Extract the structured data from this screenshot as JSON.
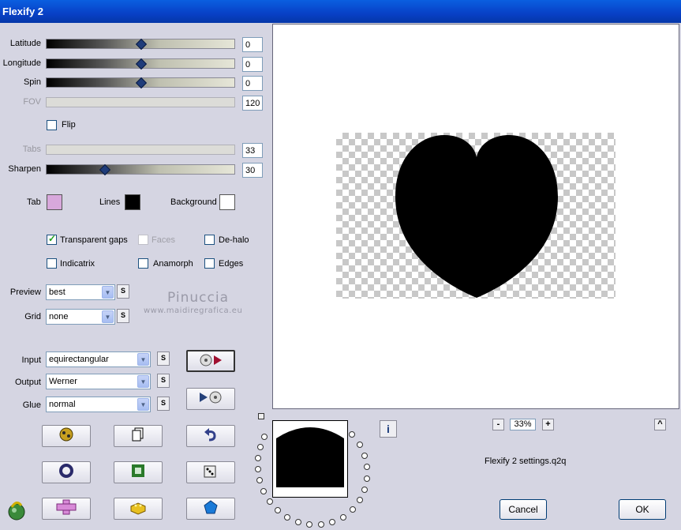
{
  "window": {
    "title": "Flexify 2"
  },
  "sliders": [
    {
      "label": "Latitude",
      "value": "0",
      "enabled": true
    },
    {
      "label": "Longitude",
      "value": "0",
      "enabled": true
    },
    {
      "label": "Spin",
      "value": "0",
      "enabled": true
    },
    {
      "label": "FOV",
      "value": "120",
      "enabled": false
    },
    {
      "label": "Tabs",
      "value": "33",
      "enabled": false
    },
    {
      "label": "Sharpen",
      "value": "30",
      "enabled": true
    }
  ],
  "flip": {
    "label": "Flip",
    "checked": false
  },
  "colors": {
    "tab": {
      "label": "Tab",
      "color": "#d8a8dc"
    },
    "lines": {
      "label": "Lines",
      "color": "#000000"
    },
    "background": {
      "label": "Background",
      "color": "#ffffff"
    }
  },
  "options": {
    "transparent_gaps": {
      "label": "Transparent gaps",
      "checked": true
    },
    "faces": {
      "label": "Faces",
      "checked": false,
      "enabled": false
    },
    "de_halo": {
      "label": "De-halo",
      "checked": false
    },
    "indicatrix": {
      "label": "Indicatrix",
      "checked": false
    },
    "anamorph": {
      "label": "Anamorph",
      "checked": false
    },
    "edges": {
      "label": "Edges",
      "checked": false
    }
  },
  "preview_select": {
    "label": "Preview",
    "value": "best",
    "s": "S"
  },
  "grid_select": {
    "label": "Grid",
    "value": "none",
    "s": "S"
  },
  "input_select": {
    "label": "Input",
    "value": "equirectangular",
    "s": "S"
  },
  "output_select": {
    "label": "Output",
    "value": "Werner",
    "s": "S"
  },
  "glue_select": {
    "label": "Glue",
    "value": "normal",
    "s": "S"
  },
  "watermark": {
    "name": "Pinuccia",
    "url": "www.maidiregrafica.eu"
  },
  "zoom": {
    "minus": "-",
    "value": "33%",
    "plus": "+"
  },
  "settings_file": "Flexify 2 settings.q2q",
  "buttons": {
    "cancel": "Cancel",
    "ok": "OK",
    "info": "i",
    "scroll_up": "^"
  },
  "accent_color": "#0a5fe0"
}
